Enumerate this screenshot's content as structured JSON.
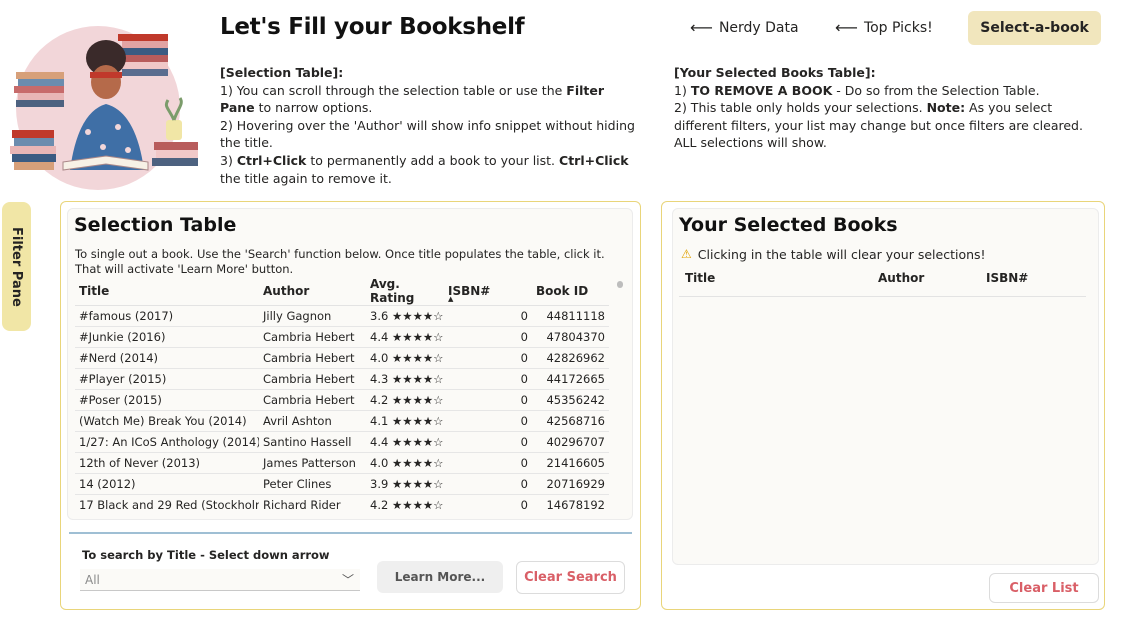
{
  "header": {
    "title": "Let's Fill your Bookshelf",
    "nav": [
      {
        "label": "Nerdy Data",
        "icon": "arrow-left-icon"
      },
      {
        "label": "Top Picks!",
        "icon": "arrow-left-icon"
      }
    ],
    "active_nav": "Select-a-book"
  },
  "instructions_left": {
    "heading": "[Selection Table]:",
    "line1_a": "1) You can scroll through the selection table or use the ",
    "line1_b": "Filter Pane",
    "line1_c": " to narrow options.",
    "line2": "2) Hovering over the 'Author' will show info snippet without hiding the title.",
    "line3_a": "3) ",
    "line3_b": "Ctrl+Click",
    "line3_c": " to permanently add a book to your list. ",
    "line3_d": "Ctrl+Click",
    "line3_e": " the title again to remove it."
  },
  "instructions_right": {
    "heading": "[Your Selected Books Table]:",
    "line1_a": "1) ",
    "line1_b": "TO REMOVE A BOOK",
    "line1_c": " -  Do so from the Selection Table.",
    "line2_a": "2) This table only holds your selections. ",
    "line2_b": "Note:",
    "line2_c": " As you select different filters, your list may change but once filters are cleared. ALL selections will show."
  },
  "filter_pane": {
    "label": "Filter Pane"
  },
  "selection": {
    "title": "Selection Table",
    "description": "To single out a book. Use the 'Search' function below. Once title populates the table, click it. That will activate 'Learn More' button.",
    "columns": [
      "Title",
      "Author",
      "Avg. Rating",
      "ISBN#",
      "Book ID"
    ],
    "rows": [
      {
        "title": "#famous (2017)",
        "author": "Jilly Gagnon",
        "rating": "3.6 ★★★★☆",
        "isbn": "0",
        "book_id": "44811118"
      },
      {
        "title": "#Junkie (2016)",
        "author": "Cambria Hebert",
        "rating": "4.4 ★★★★☆",
        "isbn": "0",
        "book_id": "47804370"
      },
      {
        "title": "#Nerd (2014)",
        "author": "Cambria Hebert",
        "rating": "4.0 ★★★★☆",
        "isbn": "0",
        "book_id": "42826962"
      },
      {
        "title": "#Player (2015)",
        "author": "Cambria Hebert",
        "rating": "4.3 ★★★★☆",
        "isbn": "0",
        "book_id": "44172665"
      },
      {
        "title": "#Poser (2015)",
        "author": "Cambria Hebert",
        "rating": "4.2 ★★★★☆",
        "isbn": "0",
        "book_id": "45356242"
      },
      {
        "title": "(Watch Me) Break You (2014)",
        "author": "Avril Ashton",
        "rating": "4.1 ★★★★☆",
        "isbn": "0",
        "book_id": "42568716"
      },
      {
        "title": "1/27: An ICoS Anthology (2014)",
        "author": "Santino Hassell",
        "rating": "4.4 ★★★★☆",
        "isbn": "0",
        "book_id": "40296707"
      },
      {
        "title": "12th of Never (2013)",
        "author": "James Patterson",
        "rating": "4.0 ★★★★☆",
        "isbn": "0",
        "book_id": "21416605"
      },
      {
        "title": "14 (2012)",
        "author": "Peter Clines",
        "rating": "3.9 ★★★★☆",
        "isbn": "0",
        "book_id": "20716929"
      },
      {
        "title": "17 Black and 29 Red (Stockholm",
        "author": "Richard Rider",
        "rating": "4.2 ★★★★☆",
        "isbn": "0",
        "book_id": "14678192"
      }
    ],
    "search_label": "To search by Title - Select down arrow",
    "dropdown_value": "All",
    "learn_more": "Learn More...",
    "clear_search": "Clear Search"
  },
  "selected": {
    "title": "Your Selected Books",
    "warning": "Clicking in the table will clear your selections!",
    "columns": [
      "Title",
      "Author",
      "ISBN#"
    ],
    "clear_list": "Clear List"
  },
  "colors": {
    "accent_gold": "#f1e6bd",
    "panel_border": "#e9d57a",
    "danger_red": "#d95f67"
  }
}
